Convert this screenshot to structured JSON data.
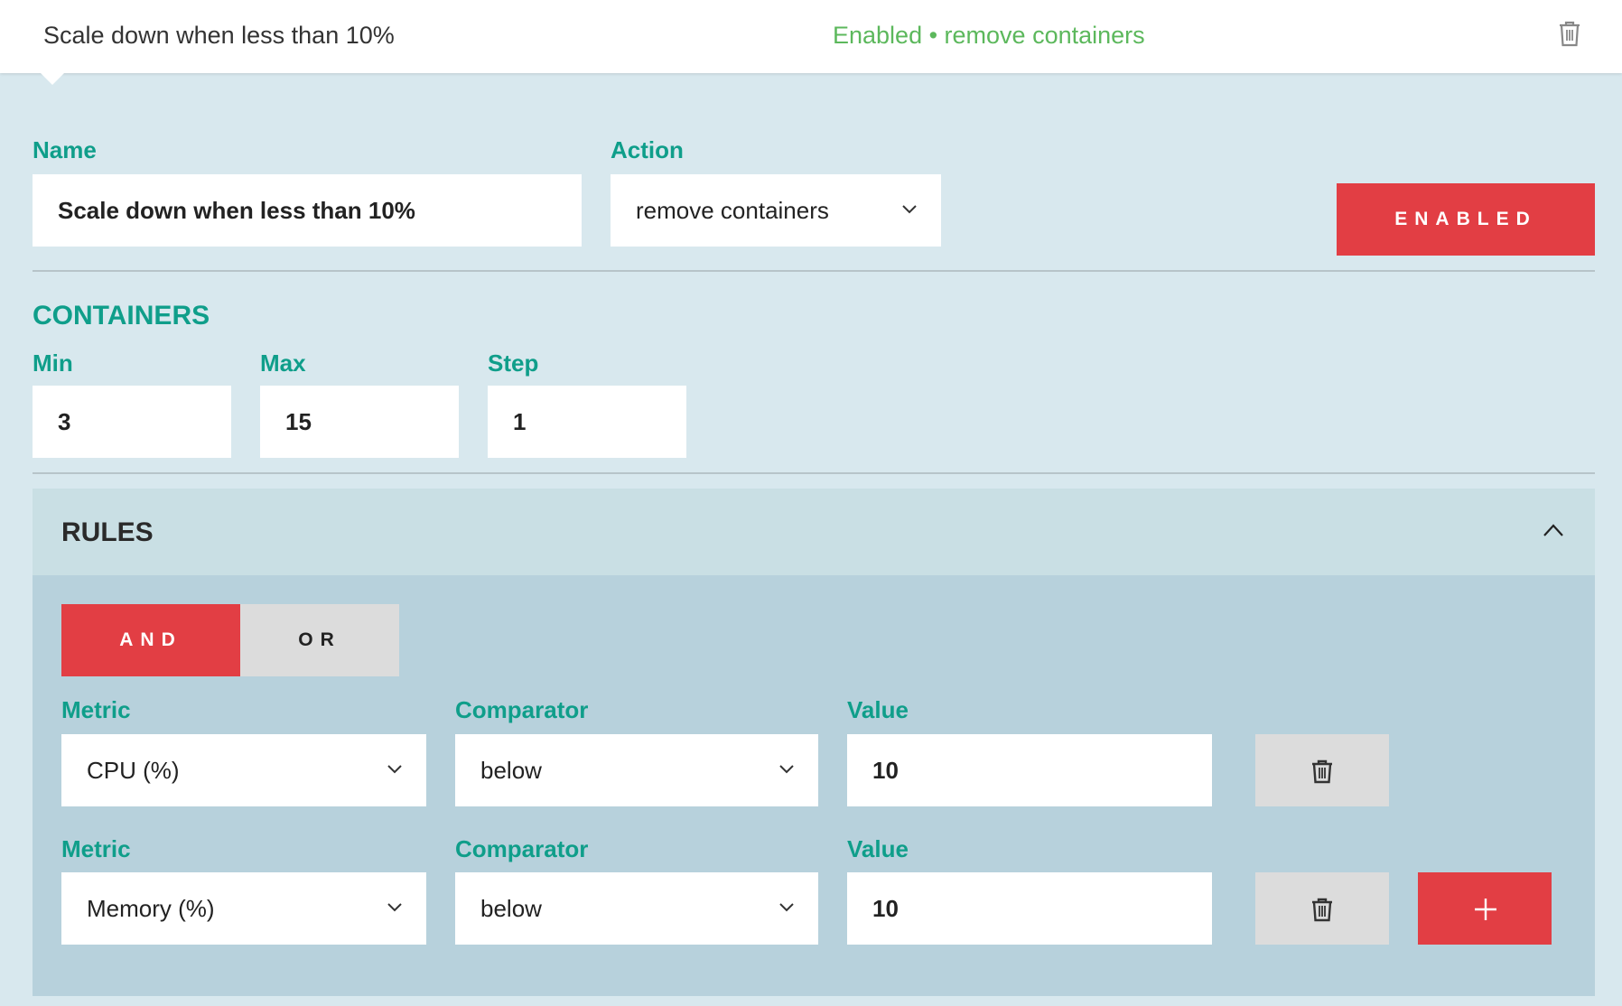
{
  "header": {
    "title": "Scale down when less than 10%",
    "status": "Enabled • remove containers",
    "delete_icon": "trash-icon"
  },
  "form": {
    "name_label": "Name",
    "name_value": "Scale down when less than 10%",
    "action_label": "Action",
    "action_value": "remove containers",
    "enabled_button": "ENABLED"
  },
  "containers": {
    "heading": "CONTAINERS",
    "min_label": "Min",
    "min_value": "3",
    "max_label": "Max",
    "max_value": "15",
    "step_label": "Step",
    "step_value": "1"
  },
  "rules": {
    "heading": "RULES",
    "collapse_icon": "chevron-up-icon",
    "and_label": "AND",
    "or_label": "OR",
    "items": [
      {
        "metric_label": "Metric",
        "metric_value": "CPU (%)",
        "comparator_label": "Comparator",
        "comparator_value": "below",
        "value_label": "Value",
        "value_value": "10"
      },
      {
        "metric_label": "Metric",
        "metric_value": "Memory (%)",
        "comparator_label": "Comparator",
        "comparator_value": "below",
        "value_label": "Value",
        "value_value": "10"
      }
    ],
    "add_icon": "plus-icon"
  },
  "colors": {
    "accent_teal": "#0f9e8a",
    "status_green": "#5cb85c",
    "button_red": "#e23e44"
  }
}
